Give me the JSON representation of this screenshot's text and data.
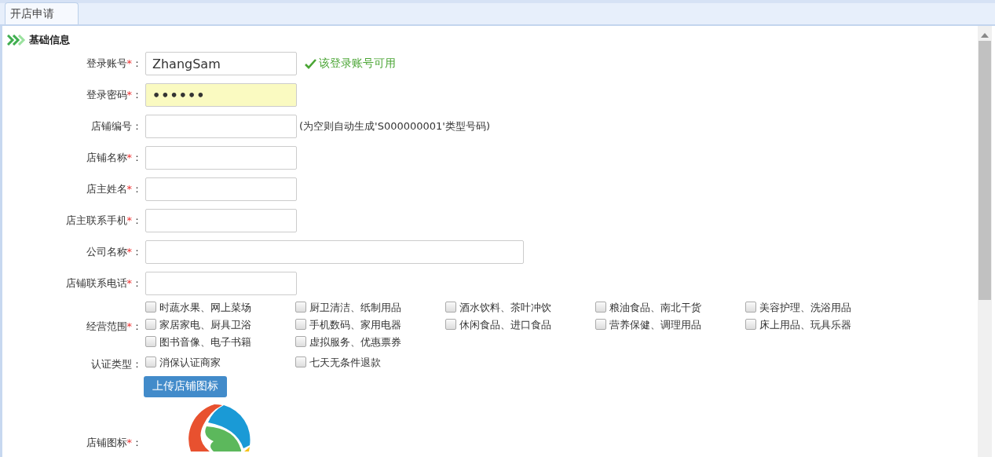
{
  "tabs": [
    {
      "label": "开店申请",
      "selected": true
    }
  ],
  "section": {
    "title": "基础信息"
  },
  "fields": [
    {
      "label": "登录账号",
      "required_mark": "*",
      "colon": "：",
      "kind": "text",
      "value": "ZhangSam",
      "highlighted": false,
      "wide": false,
      "status_message": "该登录账号可用"
    },
    {
      "label": "登录密码",
      "required_mark": "*",
      "colon": "：",
      "kind": "password",
      "value": "••••••",
      "highlighted": true,
      "wide": false
    },
    {
      "label": "店铺编号",
      "colon": "：",
      "kind": "text",
      "highlighted": false,
      "wide": false,
      "hint": "(为空则自动生成'S000000001'类型号码)"
    },
    {
      "label": "店铺名称",
      "required_mark": "*",
      "colon": "：",
      "kind": "text",
      "highlighted": false,
      "wide": false
    },
    {
      "label": "店主姓名",
      "required_mark": "*",
      "colon": "：",
      "kind": "text",
      "highlighted": false,
      "wide": false
    },
    {
      "label": "店主联系手机",
      "required_mark": "*",
      "colon": "：",
      "kind": "text",
      "highlighted": false,
      "wide": false
    },
    {
      "label": "公司名称",
      "required_mark": "*",
      "colon": "：",
      "kind": "text",
      "highlighted": false,
      "wide": true
    },
    {
      "label": "店铺联系电话",
      "required_mark": "*",
      "colon": "：",
      "kind": "text",
      "highlighted": false,
      "wide": false
    }
  ],
  "checkbox_groups": [
    {
      "label": "经营范围",
      "required_mark": "*",
      "colon": "：",
      "options": [
        {
          "label": "时蔬水果、网上菜场",
          "checked": false
        },
        {
          "label": "厨卫清洁、纸制用品",
          "checked": false
        },
        {
          "label": "酒水饮料、茶叶冲饮",
          "checked": false
        },
        {
          "label": "粮油食品、南北干货",
          "checked": false
        },
        {
          "label": "美容护理、洗浴用品",
          "checked": false
        },
        {
          "label": "家居家电、厨具卫浴",
          "checked": false
        },
        {
          "label": "手机数码、家用电器",
          "checked": false
        },
        {
          "label": "休闲食品、进口食品",
          "checked": false
        },
        {
          "label": "营养保健、调理用品",
          "checked": false
        },
        {
          "label": "床上用品、玩具乐器",
          "checked": false
        },
        {
          "label": "图书音像、电子书籍",
          "checked": false
        },
        {
          "label": "虚拟服务、优惠票券",
          "checked": false
        }
      ]
    },
    {
      "label": "认证类型",
      "colon": "：",
      "options": [
        {
          "label": "消保认证商家",
          "checked": false
        },
        {
          "label": "七天无条件退款",
          "checked": false
        }
      ]
    }
  ],
  "upload_button": "上传店铺图标",
  "logo_field": {
    "label": "店铺图标",
    "required_mark": "*",
    "colon": "："
  }
}
